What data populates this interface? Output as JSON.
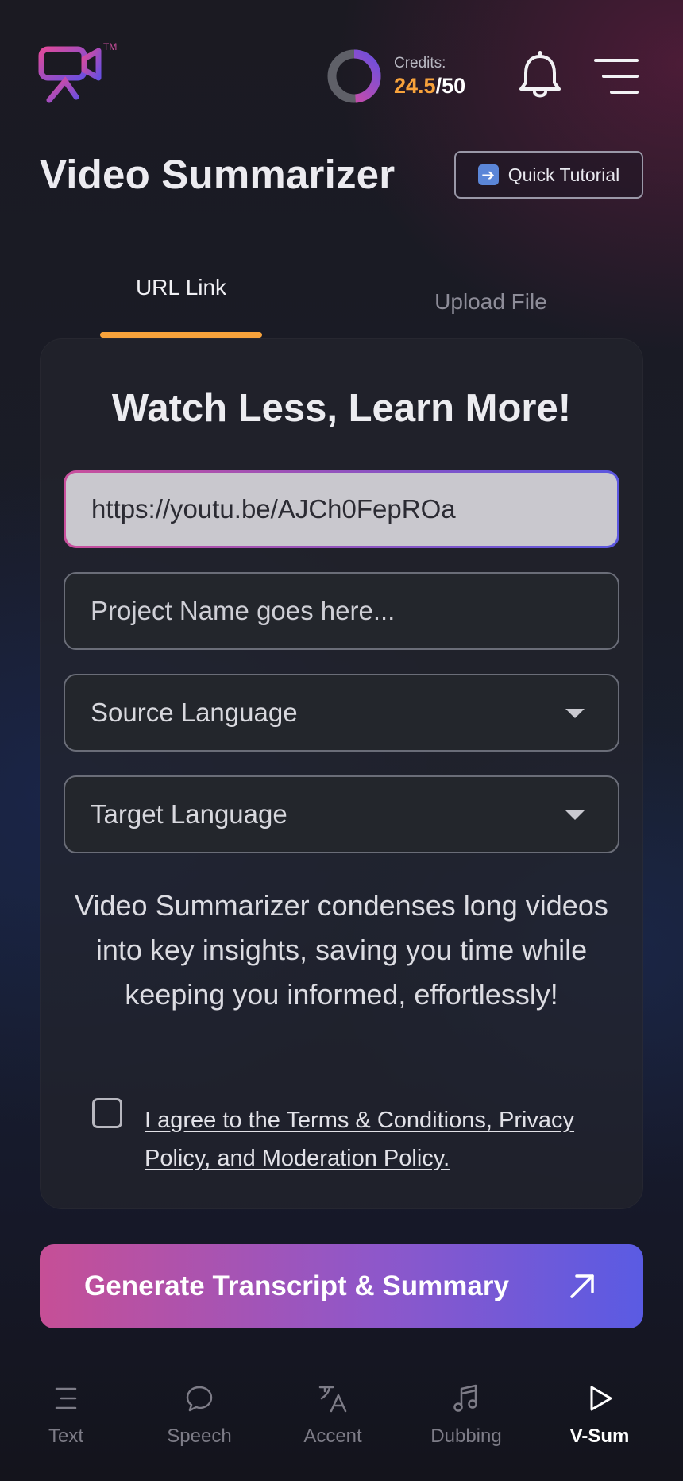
{
  "header": {
    "logo_tm": "TM",
    "credits_label": "Credits:",
    "credits_used": "24.5",
    "credits_total": "/50"
  },
  "page": {
    "title": "Video Summarizer",
    "tutorial_label": "Quick Tutorial"
  },
  "tabs": [
    {
      "label": "URL Link",
      "active": true
    },
    {
      "label": "Upload File",
      "active": false
    }
  ],
  "form": {
    "heading": "Watch Less, Learn More!",
    "url_value": "https://youtu.be/AJCh0FepROa",
    "project_placeholder": "Project Name goes here...",
    "source_language": "Source Language",
    "target_language": "Target Language",
    "description": "Video Summarizer condenses long videos into key insights, saving you time while keeping you informed, effortlessly!",
    "terms_text": "I agree to the Terms & Conditions, Privacy Policy, and Moderation Policy."
  },
  "cta": {
    "label": "Generate Transcript & Summary"
  },
  "nav": [
    {
      "label": "Text",
      "icon": "text-icon",
      "active": false
    },
    {
      "label": "Speech",
      "icon": "speech-bubble-icon",
      "active": false
    },
    {
      "label": "Accent",
      "icon": "translate-icon",
      "active": false
    },
    {
      "label": "Dubbing",
      "icon": "music-note-icon",
      "active": false
    },
    {
      "label": "V-Sum",
      "icon": "play-icon",
      "active": true
    }
  ],
  "colors": {
    "accent_orange": "#f7a23b",
    "gradient_start": "#c64f96",
    "gradient_end": "#5a5be3"
  }
}
